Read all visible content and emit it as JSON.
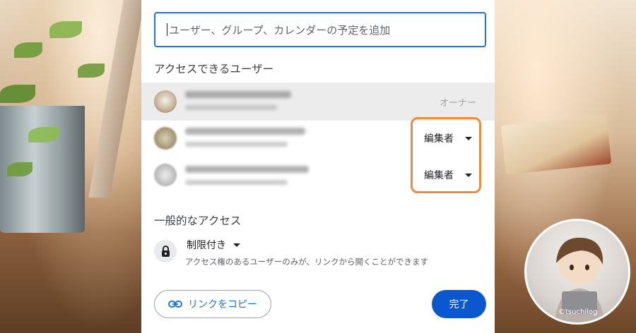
{
  "share_dialog": {
    "add_placeholder": "ユーザー、グループ、カレンダーの予定を追加",
    "access_section_title": "アクセスできるユーザー",
    "people": [
      {
        "role": "オーナー"
      },
      {
        "role": "編集者"
      },
      {
        "role": "編集者"
      }
    ],
    "general_access_title": "一般的なアクセス",
    "general_access_value": "制限付き",
    "general_access_description": "アクセス権のあるユーザーのみが、リンクから開くことができます",
    "copy_link_label": "リンクをコピー",
    "done_label": "完了"
  },
  "watermark": {
    "text": "©tsuchilog"
  },
  "colors": {
    "accent": "#1a73e8",
    "primary_button": "#0b57d0",
    "highlight": "#f08a3c",
    "owner_row_bg": "#ececec"
  },
  "icons": [
    "link-icon",
    "lock-icon",
    "dropdown-arrow-icon"
  ]
}
